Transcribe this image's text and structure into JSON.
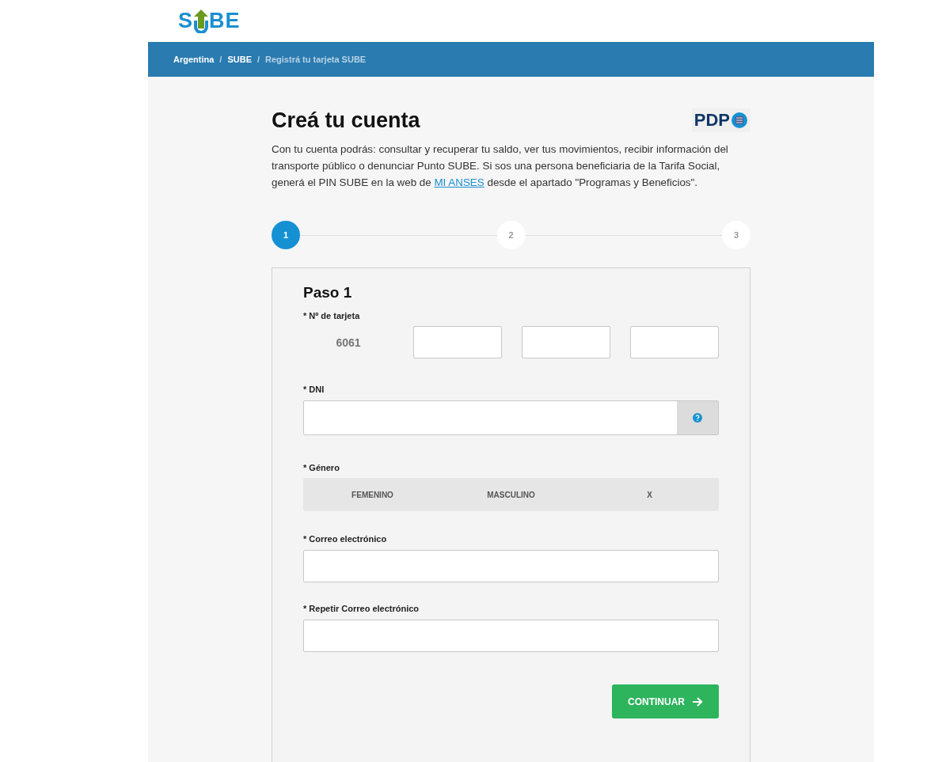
{
  "logo": {
    "before": "S",
    "after": "BE"
  },
  "breadcrumb": [
    {
      "label": "Argentina",
      "current": false
    },
    {
      "label": "SUBE",
      "current": false
    },
    {
      "label": "Registrá tu tarjeta SUBE",
      "current": true
    }
  ],
  "breadcrumb_separator": "/",
  "title": "Creá tu cuenta",
  "badge": {
    "text": "PDP"
  },
  "intro": {
    "before": "Con tu cuenta podrás: consultar y recuperar tu saldo, ver tus movimientos, recibir información del transporte público o denunciar Punto SUBE. Si sos una persona beneficiaria de la Tarifa Social, generá el PIN SUBE en la web de",
    "link": "MI ANSES",
    "after": "desde el apartado \"Programas y Beneficios\"."
  },
  "steps": [
    {
      "label": "1",
      "selected": true
    },
    {
      "label": "2",
      "selected": false
    },
    {
      "label": "3",
      "selected": false
    }
  ],
  "form": {
    "heading": "Paso 1",
    "card_label": "* Nº de tarjeta",
    "card_prefix": "6061",
    "dni_label": "* DNI",
    "gender_label": "* Género",
    "genders": [
      {
        "label": "FEMENINO",
        "selected": false
      },
      {
        "label": "MASCULINO",
        "selected": false
      },
      {
        "label": "X",
        "selected": false
      }
    ],
    "email_label": "* Correo electrónico",
    "email_repeat_label": "* Repetir Correo electrónico",
    "submit": "CONTINUAR"
  }
}
